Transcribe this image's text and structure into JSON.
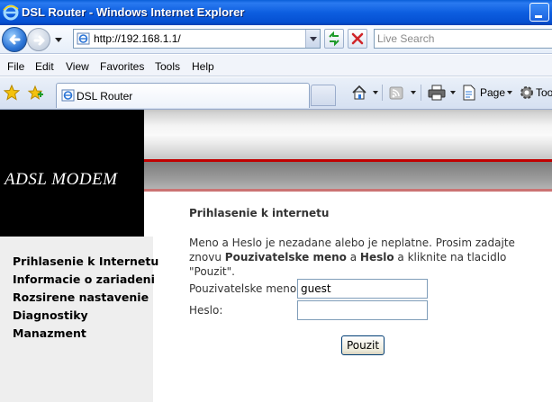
{
  "window": {
    "title": "DSL Router - Windows Internet Explorer"
  },
  "address_bar": {
    "url": "http://192.168.1.1/",
    "search_placeholder": "Live Search"
  },
  "menu": {
    "items": [
      "File",
      "Edit",
      "View",
      "Favorites",
      "Tools",
      "Help"
    ]
  },
  "tabs": {
    "active_label": "DSL Router"
  },
  "command_bar": {
    "page_label": "Page",
    "tools_label": "Too"
  },
  "page": {
    "logo_text": "ADSL MODEM",
    "nav_items": [
      "Prihlasenie k Internetu",
      "Informacie o zariadeni",
      "Rozsirene nastavenie",
      "Diagnostiky",
      "Manazment"
    ],
    "heading": "Prihlasenie k internetu",
    "message": {
      "part1": "Meno a Heslo je nezadane alebo je neplatne. Prosim zadajte znovu ",
      "bold_username": "Pouzivatelske meno",
      "part2": " a ",
      "bold_password": "Heslo",
      "part3": " a kliknite na tlacidlo \"Pouzit\"."
    },
    "form": {
      "username_label": "Pouzivatelske meno:",
      "username_value": "guest",
      "password_label": "Heslo:",
      "password_value": "",
      "submit_label": "Pouzit"
    }
  },
  "colors": {
    "titlebar_blue": "#0550d2",
    "accent_red": "#c00000",
    "logo_bg": "#000000",
    "sidebar_bg": "#eeeeee"
  }
}
